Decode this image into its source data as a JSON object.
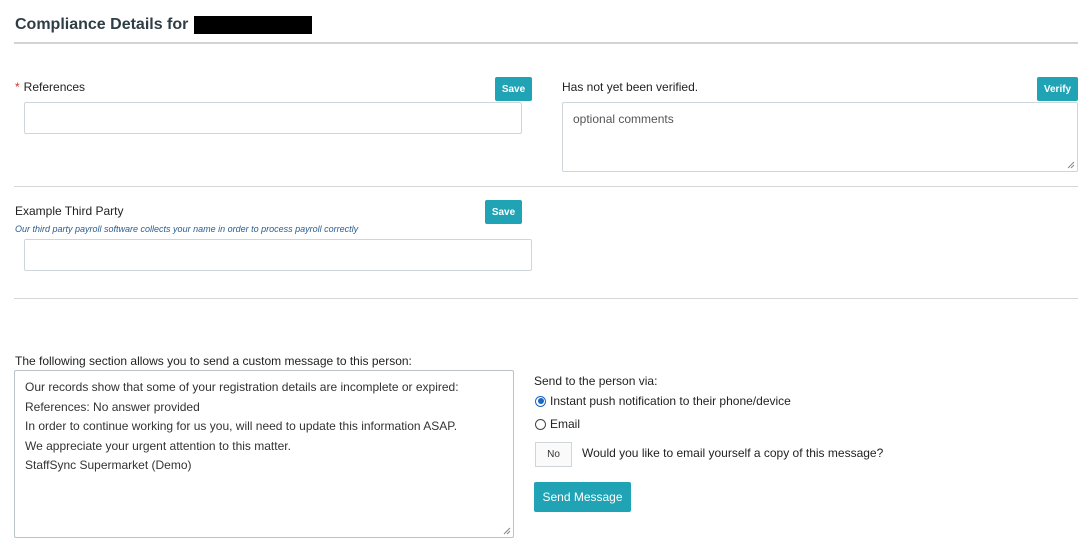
{
  "header": {
    "title": "Compliance Details for"
  },
  "references": {
    "required_mark": "*",
    "label": "References",
    "save_label": "Save",
    "value": ""
  },
  "verification": {
    "status": "Has not yet been verified.",
    "verify_label": "Verify",
    "comments_placeholder": "optional comments"
  },
  "third_party": {
    "label": "Example Third Party",
    "save_label": "Save",
    "hint": "Our third party payroll software collects your name in order to process payroll correctly",
    "value": ""
  },
  "message": {
    "intro": "The following section allows you to send a custom message to this person:",
    "lines": [
      "Our records show that some of your registration details are incomplete or expired:",
      "References: No answer provided",
      "In order to continue working for us you, will need to update this information ASAP.",
      "We appreciate your urgent attention to this matter.",
      "StaffSync Supermarket (Demo)"
    ]
  },
  "send_options": {
    "label": "Send to the person via:",
    "options": [
      {
        "label": "Instant push notification to their phone/device",
        "selected": true
      },
      {
        "label": "Email",
        "selected": false
      }
    ],
    "copy_toggle": "No",
    "copy_question": "Would you like to email yourself a copy of this message?",
    "send_label": "Send Message"
  },
  "colors": {
    "accent": "#1fa3b5",
    "required": "#d0342c",
    "hint": "#2a5d8f"
  }
}
